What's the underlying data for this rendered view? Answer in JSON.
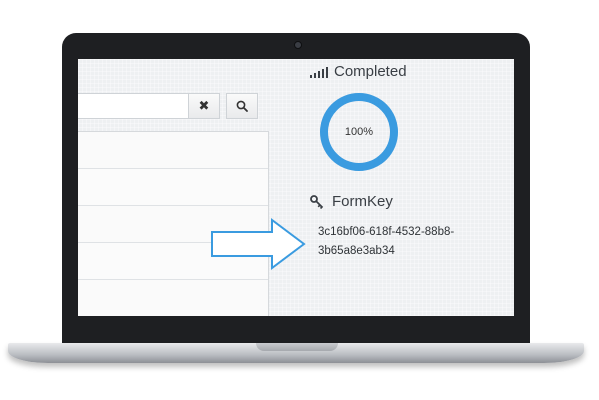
{
  "search": {
    "placeholder": "",
    "value": ""
  },
  "buttons": {
    "clear_icon": "✖",
    "search_icon": "🔍"
  },
  "list": {
    "items": [
      "",
      "",
      "",
      "",
      ""
    ]
  },
  "status": {
    "label": "Completed",
    "icon": "signal-bars-icon"
  },
  "progress": {
    "value": 1.0,
    "label": "100%",
    "color": "#3a9be0"
  },
  "formkey": {
    "label": "FormKey",
    "icon": "key-icon",
    "value_line1": "3c16bf06-618f-4532-88b8-",
    "value_line2": "3b65a8e3ab34"
  },
  "callout": {
    "icon": "arrow-right-icon",
    "color": "#3a9be0"
  }
}
